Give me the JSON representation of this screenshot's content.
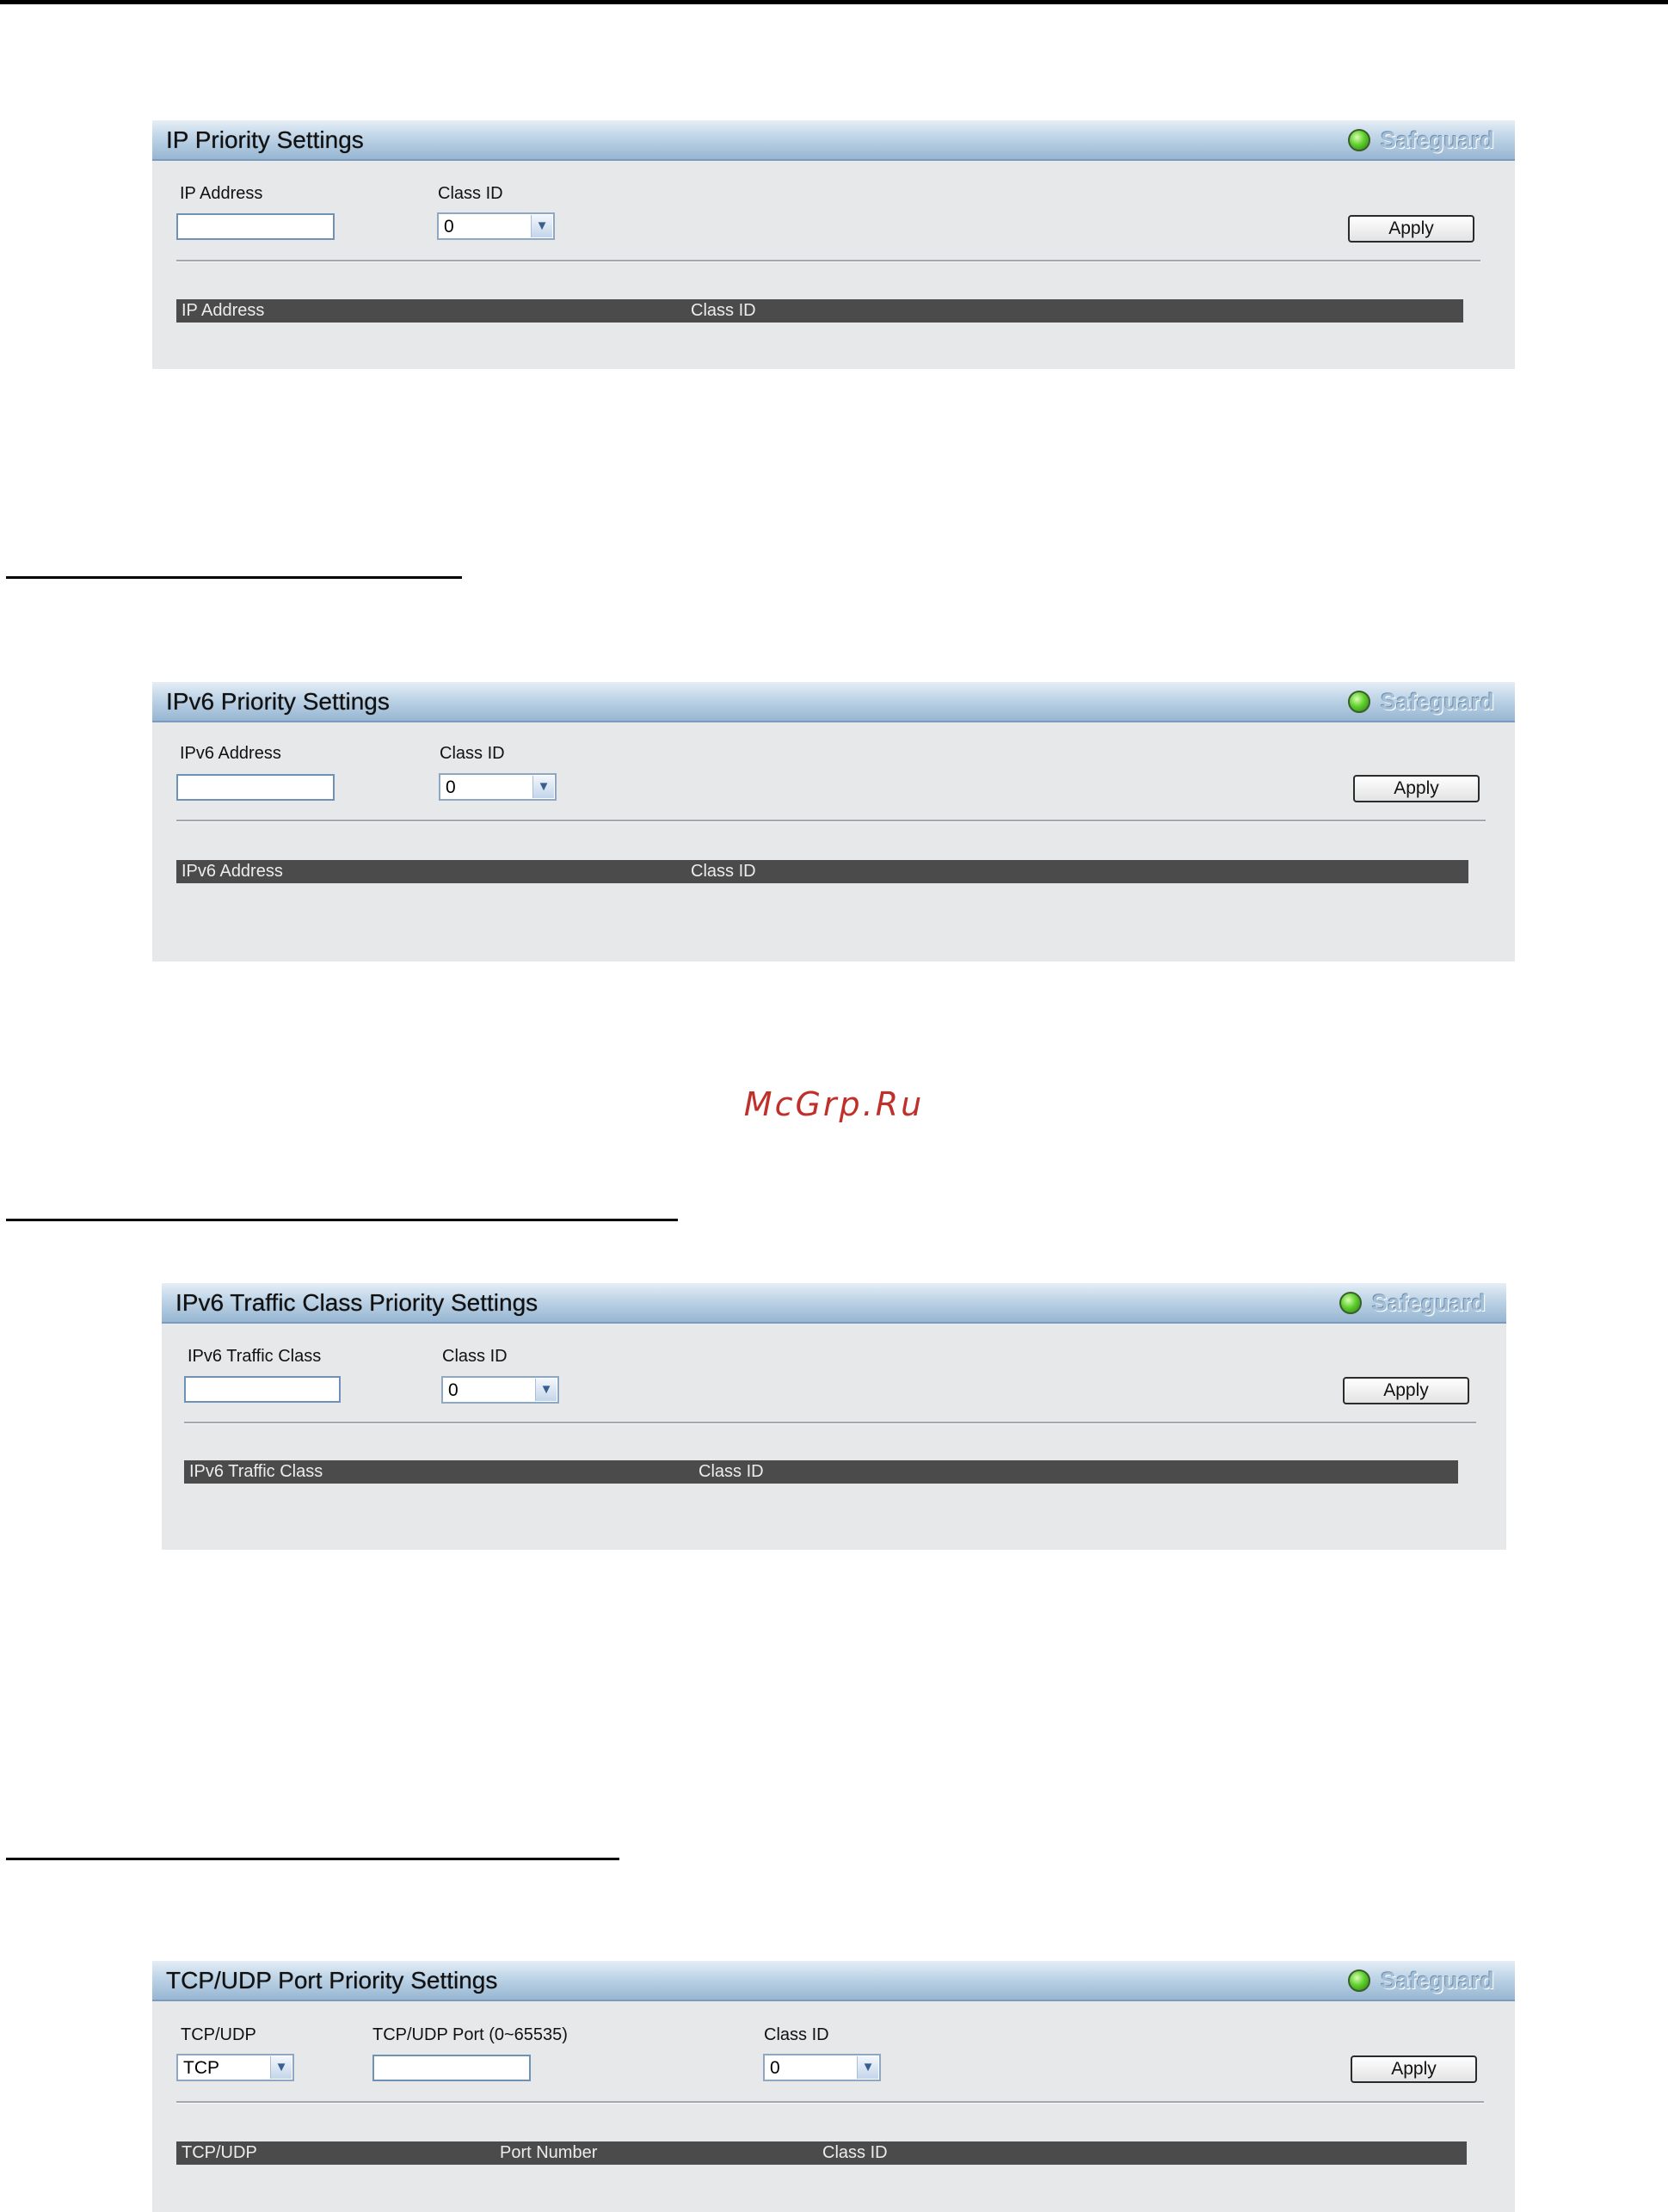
{
  "panels": {
    "ip": {
      "title": "IP Priority Settings",
      "safeguard": "Safeguard",
      "fields": {
        "address_label": "IP Address",
        "address_value": "",
        "class_label": "Class ID",
        "class_value": "0"
      },
      "apply": "Apply",
      "columns": [
        "IP Address",
        "Class ID"
      ]
    },
    "ipv6": {
      "title": "IPv6 Priority Settings",
      "safeguard": "Safeguard",
      "fields": {
        "address_label": "IPv6 Address",
        "address_value": "",
        "class_label": "Class ID",
        "class_value": "0"
      },
      "apply": "Apply",
      "columns": [
        "IPv6 Address",
        "Class ID"
      ]
    },
    "ipv6_traffic": {
      "title": "IPv6 Traffic Class Priority Settings",
      "safeguard": "Safeguard",
      "fields": {
        "traffic_label": "IPv6 Traffic Class",
        "traffic_value": "",
        "class_label": "Class ID",
        "class_value": "0"
      },
      "apply": "Apply",
      "columns": [
        "IPv6 Traffic Class",
        "Class ID"
      ]
    },
    "tcpudp": {
      "title": "TCP/UDP Port Priority Settings",
      "safeguard": "Safeguard",
      "fields": {
        "protocol_label": "TCP/UDP",
        "protocol_value": "TCP",
        "port_label": "TCP/UDP Port (0~65535)",
        "port_value": "",
        "class_label": "Class ID",
        "class_value": "0"
      },
      "apply": "Apply",
      "columns": [
        "TCP/UDP",
        "Port Number",
        "Class ID"
      ]
    }
  },
  "watermark": "McGrp.Ru",
  "icons": {
    "status": "green-status-icon",
    "dropdown": "chevron-down-icon"
  },
  "colors": {
    "header_start": "#e5eef6",
    "header_end": "#97b6d2",
    "panel_bg": "#e6e8ea",
    "table_head": "#4b4b4b",
    "watermark": "#c0302a"
  }
}
